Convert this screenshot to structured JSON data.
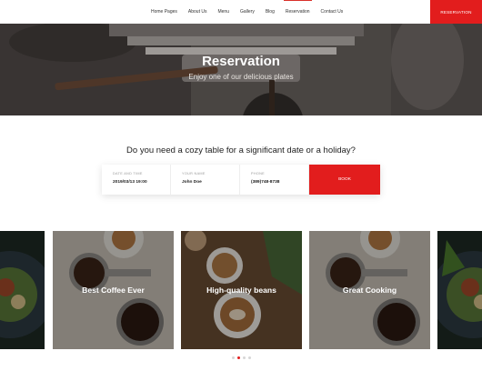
{
  "nav": {
    "items": [
      {
        "label": "Home Pages"
      },
      {
        "label": "About Us"
      },
      {
        "label": "Menu"
      },
      {
        "label": "Gallery"
      },
      {
        "label": "Blog"
      },
      {
        "label": "Reservation"
      },
      {
        "label": "Contact Us"
      }
    ],
    "active": "Reservation",
    "cta": "RESERVATION"
  },
  "hero": {
    "title": "Reservation",
    "subtitle": "Enjoy one of our delicious plates"
  },
  "reservation": {
    "question": "Do you need a cozy table for a significant date or a holiday?",
    "fields": [
      {
        "label": "DATE AND TIME",
        "value": "2019/03/13 19:00"
      },
      {
        "label": "YOUR NAME",
        "value": "John Doe"
      },
      {
        "label": "PHONE",
        "value": "(389)748-8738"
      }
    ],
    "book_label": "BOOK"
  },
  "cards": [
    {
      "title": "",
      "image": "salad-dish-image"
    },
    {
      "title": "Best Coffee Ever",
      "image": "coffee-grinder-image"
    },
    {
      "title": "High-quality beans",
      "image": "latte-cups-image"
    },
    {
      "title": "Great Cooking",
      "image": "coffee-grinder-image"
    },
    {
      "title": "",
      "image": "salad-dish-image"
    }
  ],
  "carousel": {
    "dot_count": 4,
    "active_index": 1
  },
  "colors": {
    "accent": "#e21d1d"
  }
}
